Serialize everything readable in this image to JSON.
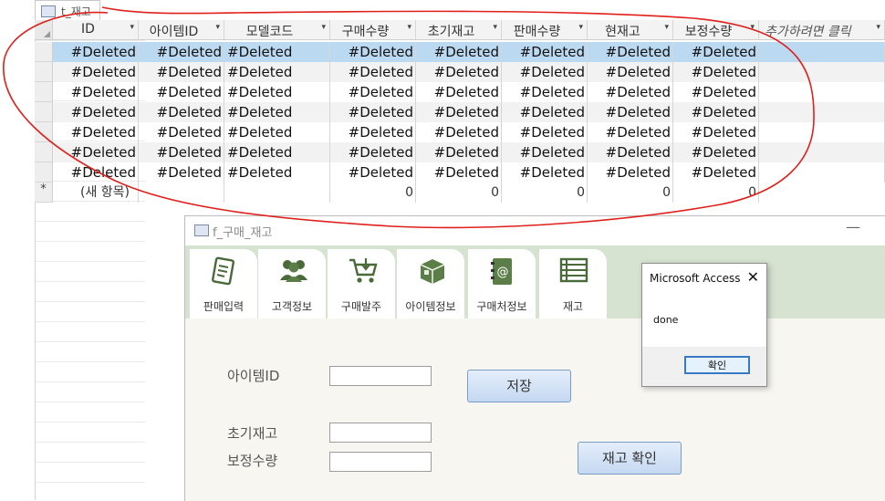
{
  "table_window": {
    "tab_label": "t_재고",
    "columns": [
      "ID",
      "아이템ID",
      "모델코드",
      "구매수량",
      "초기재고",
      "판매수량",
      "현재고",
      "보정수량",
      "추가하려면 클릭"
    ],
    "rows": [
      [
        "#Deleted",
        "#Deleted",
        "#Deleted",
        "#Deleted",
        "#Deleted",
        "#Deleted",
        "#Deleted",
        "#Deleted"
      ],
      [
        "#Deleted",
        "#Deleted",
        "#Deleted",
        "#Deleted",
        "#Deleted",
        "#Deleted",
        "#Deleted",
        "#Deleted"
      ],
      [
        "#Deleted",
        "#Deleted",
        "#Deleted",
        "#Deleted",
        "#Deleted",
        "#Deleted",
        "#Deleted",
        "#Deleted"
      ],
      [
        "#Deleted",
        "#Deleted",
        "#Deleted",
        "#Deleted",
        "#Deleted",
        "#Deleted",
        "#Deleted",
        "#Deleted"
      ],
      [
        "#Deleted",
        "#Deleted",
        "#Deleted",
        "#Deleted",
        "#Deleted",
        "#Deleted",
        "#Deleted",
        "#Deleted"
      ],
      [
        "#Deleted",
        "#Deleted",
        "#Deleted",
        "#Deleted",
        "#Deleted",
        "#Deleted",
        "#Deleted",
        "#Deleted"
      ],
      [
        "#Deleted",
        "#Deleted",
        "#Deleted",
        "#Deleted",
        "#Deleted",
        "#Deleted",
        "#Deleted",
        "#Deleted"
      ]
    ],
    "new_row": {
      "marker": "*",
      "id_text": "(새 항목)",
      "values": [
        "",
        "",
        "0",
        "0",
        "0",
        "0",
        "0"
      ]
    }
  },
  "form_window": {
    "title": "f_구매_재고",
    "minimize_glyph": "—",
    "nav": [
      {
        "label": "판매입력",
        "icon": "sales-entry-icon"
      },
      {
        "label": "고객정보",
        "icon": "customers-icon"
      },
      {
        "label": "구매발주",
        "icon": "cart-icon"
      },
      {
        "label": "아이템정보",
        "icon": "box-icon"
      },
      {
        "label": "구매처정보",
        "icon": "address-book-icon"
      },
      {
        "label": "재고",
        "icon": "list-icon"
      }
    ],
    "fields": {
      "item_id_label": "아이템ID",
      "initial_stock_label": "초기재고",
      "adjust_qty_label": "보정수량"
    },
    "buttons": {
      "save": "저장",
      "check_stock": "재고 확인"
    }
  },
  "message_box": {
    "title": "Microsoft Access",
    "text": "done",
    "ok": "확인",
    "close_glyph": "✕"
  },
  "colors": {
    "selected_row": "#bcd9f2",
    "annotation": "#e0201c",
    "nav_strip": "#d6e3d0"
  }
}
